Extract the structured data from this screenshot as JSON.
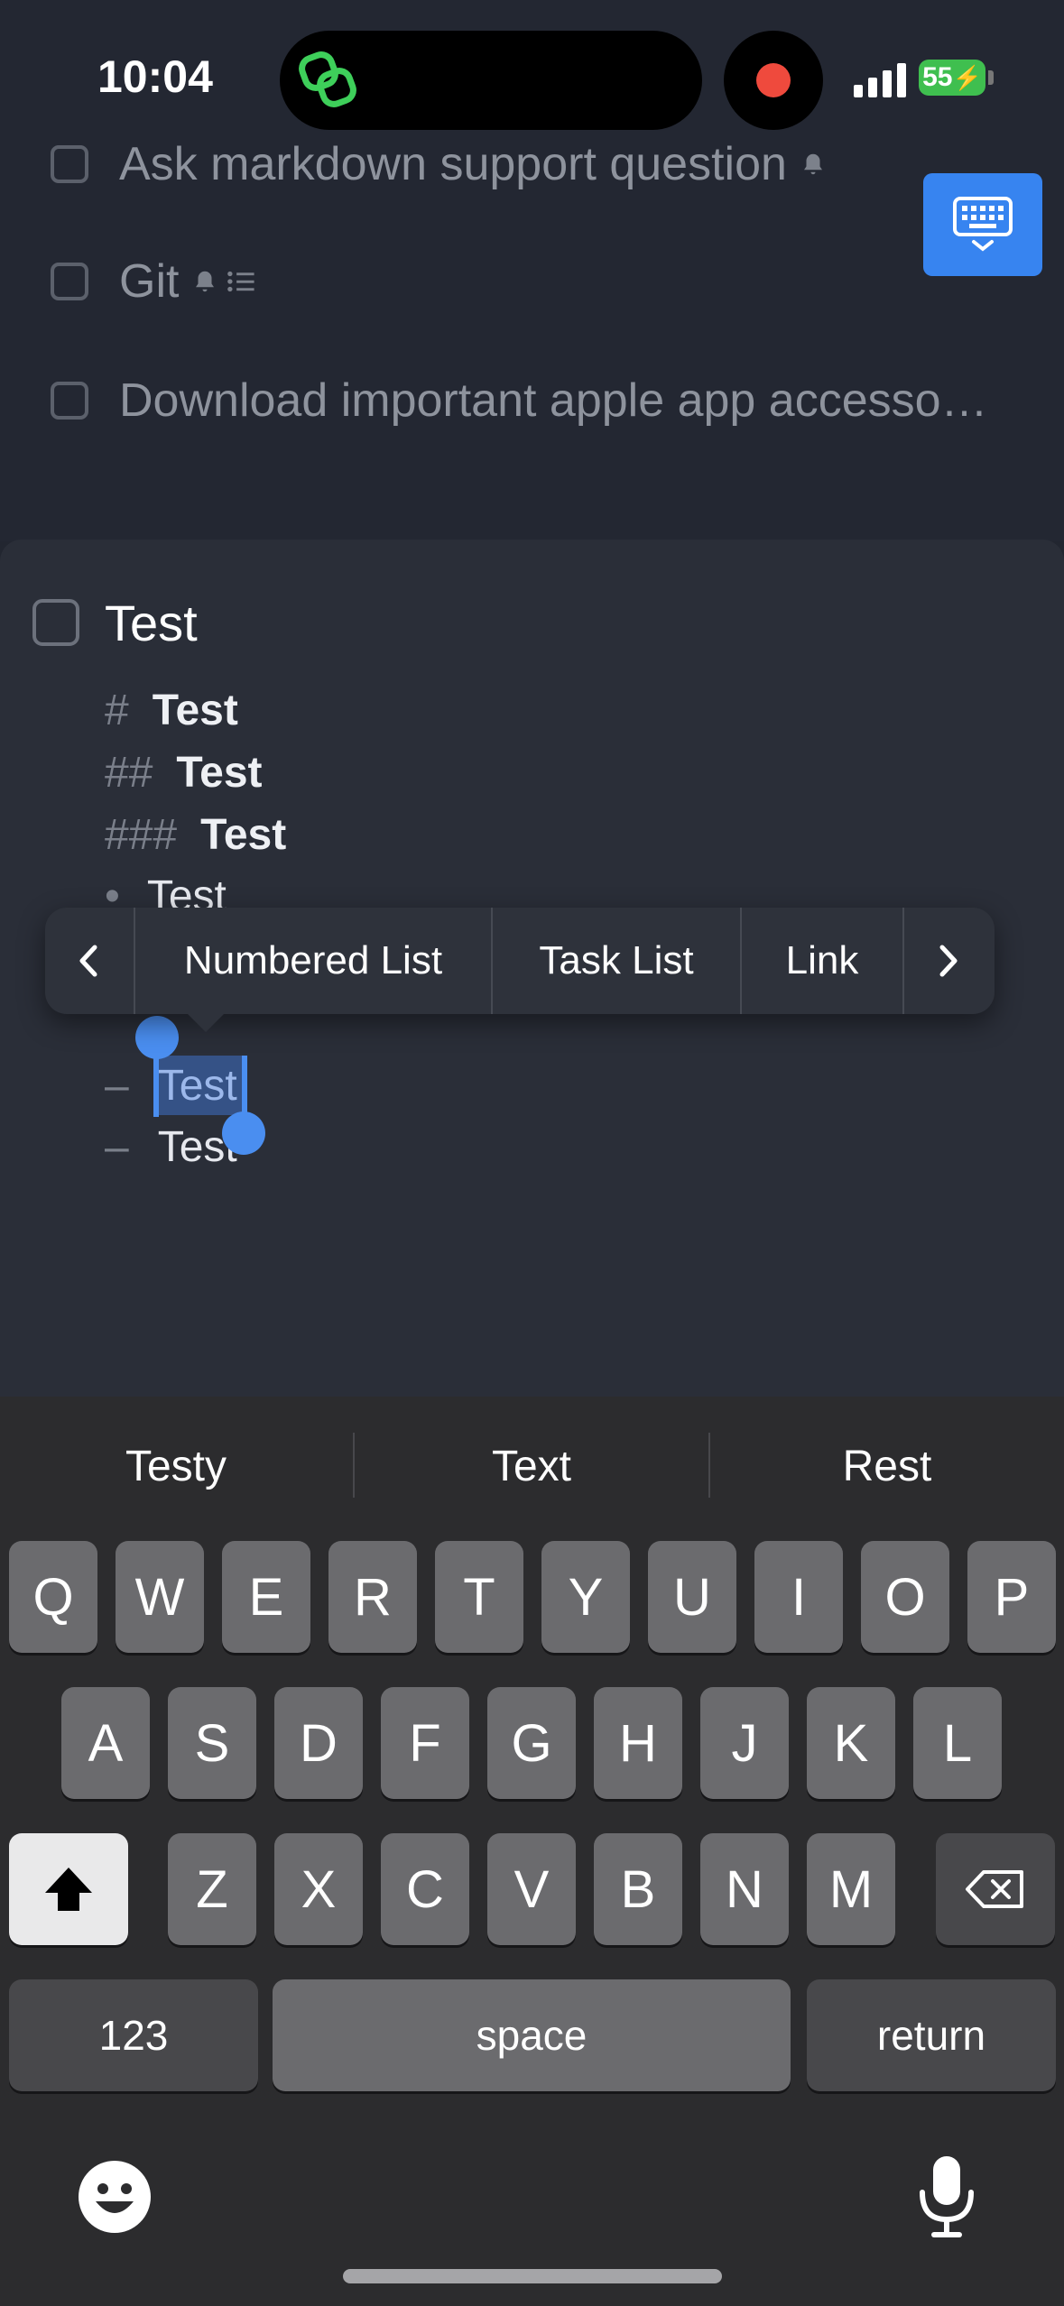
{
  "status_bar": {
    "time": "10:04",
    "battery": "55"
  },
  "background_tasks": [
    {
      "label": "Ask markdown support question"
    },
    {
      "label": "Git"
    },
    {
      "label": "Download important apple app accesso…"
    }
  ],
  "task": {
    "title": "Test",
    "lines": [
      {
        "mark": "#",
        "text": "Test",
        "style": "bold"
      },
      {
        "mark": "##",
        "text": "Test",
        "style": "bold"
      },
      {
        "mark": "###",
        "text": "Test",
        "style": "bold"
      },
      {
        "mark": "•",
        "text": "Test",
        "style": "plain"
      },
      {
        "mark": "–",
        "text": "Test",
        "style": "plain"
      },
      {
        "mark": "–",
        "text": "Test",
        "style": "plain"
      }
    ]
  },
  "context_menu": {
    "items": [
      "Numbered List",
      "Task List",
      "Link"
    ]
  },
  "suggestions": [
    "Testy",
    "Text",
    "Rest"
  ],
  "keyboard": {
    "row1": [
      "Q",
      "W",
      "E",
      "R",
      "T",
      "Y",
      "U",
      "I",
      "O",
      "P"
    ],
    "row2": [
      "A",
      "S",
      "D",
      "F",
      "G",
      "H",
      "J",
      "K",
      "L"
    ],
    "row3": [
      "Z",
      "X",
      "C",
      "V",
      "B",
      "N",
      "M"
    ],
    "numbers_label": "123",
    "space_label": "space",
    "return_label": "return"
  },
  "colors": {
    "accent": "#3784f0",
    "selection": "#4a8ef0",
    "recording": "#ef4a3d",
    "battery": "#3fbf4f"
  }
}
